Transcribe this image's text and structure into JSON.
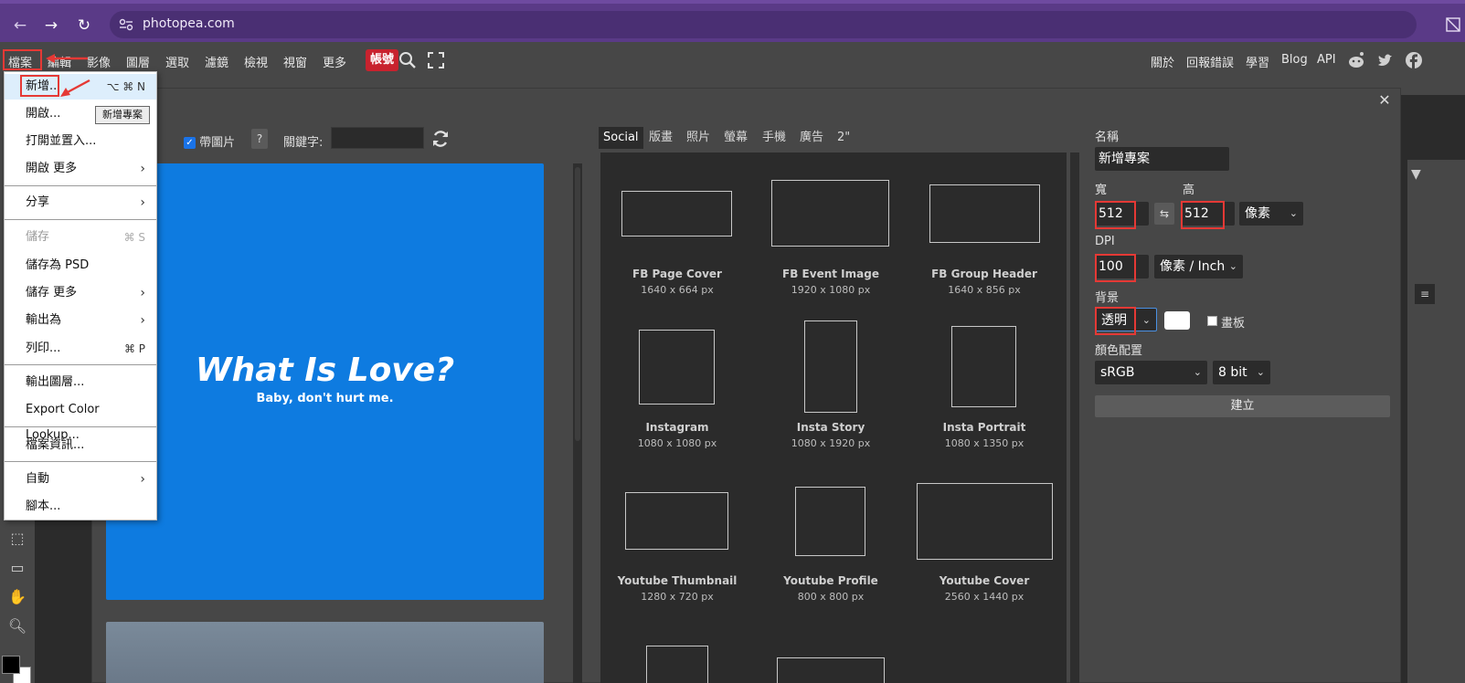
{
  "browser": {
    "url": "photopea.com",
    "back_icon": "back-arrow-icon",
    "forward_icon": "forward-arrow-icon",
    "reload_icon": "reload-icon"
  },
  "menubar": {
    "items": [
      "檔案",
      "編輯",
      "影像",
      "圖層",
      "選取",
      "濾鏡",
      "檢視",
      "視窗",
      "更多"
    ],
    "account": "帳號",
    "right": [
      "關於",
      "回報錯誤",
      "學習",
      "Blog",
      "API"
    ]
  },
  "file_menu": {
    "new": "新增...",
    "new_shortcut": "⌥ ⌘ N",
    "new_tooltip": "新增專案",
    "open": "開啟...",
    "open_place": "打開並置入...",
    "open_more": "開啟 更多",
    "share": "分享",
    "save": "儲存",
    "save_shortcut": "⌘ S",
    "save_psd": "儲存為 PSD",
    "save_more": "儲存 更多",
    "export_as": "輸出為",
    "print": "列印...",
    "print_shortcut": "⌘ P",
    "export_layers": "輸出圖層...",
    "export_lut": "Export Color Lookup...",
    "file_info": "檔案資訊...",
    "automate": "自動",
    "script": "腳本..."
  },
  "dialog": {
    "with_images": "帶圖片",
    "help": "?",
    "keyword_label": "關鍵字:",
    "sample": {
      "title": "What Is Love?",
      "subtitle": "Baby, don't hurt me."
    },
    "tabs": [
      "Social",
      "版畫",
      "照片",
      "螢幕",
      "手機",
      "廣告",
      "2\""
    ],
    "templates": [
      {
        "name": "FB Page Cover",
        "size": "1640 x 664 px"
      },
      {
        "name": "FB Event Image",
        "size": "1920 x 1080 px"
      },
      {
        "name": "FB Group Header",
        "size": "1640 x 856 px"
      },
      {
        "name": "Instagram",
        "size": "1080 x 1080 px"
      },
      {
        "name": "Insta Story",
        "size": "1080 x 1920 px"
      },
      {
        "name": "Insta Portrait",
        "size": "1080 x 1350 px"
      },
      {
        "name": "Youtube Thumbnail",
        "size": "1280 x 720 px"
      },
      {
        "name": "Youtube Profile",
        "size": "800 x 800 px"
      },
      {
        "name": "Youtube Cover",
        "size": "2560 x 1440 px"
      }
    ],
    "props": {
      "name_label": "名稱",
      "name_value": "新增專案",
      "width_label": "寬",
      "width_value": "512",
      "height_label": "高",
      "height_value": "512",
      "unit": "像素",
      "dpi_label": "DPI",
      "dpi_value": "100",
      "dpi_unit": "像素 / Inch",
      "bg_label": "背景",
      "bg_value": "透明",
      "board_label": "畫板",
      "color_label": "顏色配置",
      "color_mode": "sRGB",
      "bit_depth": "8 bit",
      "create": "建立"
    }
  },
  "colors": {
    "browser": "#5a3a87",
    "app_bg": "#474747",
    "account_red": "#c8222e",
    "sample_blue": "#0e7be0",
    "annotation_red": "#e53935"
  }
}
